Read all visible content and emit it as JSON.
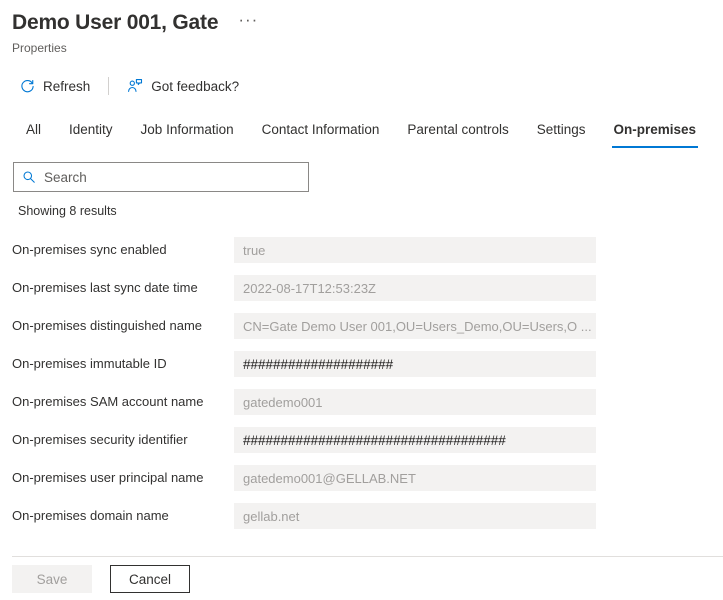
{
  "header": {
    "title": "Demo User 001, Gate",
    "more_label": "···",
    "subtitle": "Properties"
  },
  "commandbar": {
    "refresh_label": "Refresh",
    "feedback_label": "Got feedback?"
  },
  "tabs": [
    {
      "label": "All",
      "active": false
    },
    {
      "label": "Identity",
      "active": false
    },
    {
      "label": "Job Information",
      "active": false
    },
    {
      "label": "Contact Information",
      "active": false
    },
    {
      "label": "Parental controls",
      "active": false
    },
    {
      "label": "Settings",
      "active": false
    },
    {
      "label": "On-premises",
      "active": true
    }
  ],
  "search": {
    "placeholder": "Search",
    "value": ""
  },
  "results": {
    "count_text": "Showing 8 results"
  },
  "properties": [
    {
      "label": "On-premises sync enabled",
      "value": "true",
      "redacted": false
    },
    {
      "label": "On-premises last sync date time",
      "value": "2022-08-17T12:53:23Z",
      "redacted": false
    },
    {
      "label": "On-premises distinguished name",
      "value": "CN=Gate Demo User 001,OU=Users_Demo,OU=Users,O ...",
      "redacted": false
    },
    {
      "label": "On-premises immutable ID",
      "value": "####################",
      "redacted": true
    },
    {
      "label": "On-premises SAM account name",
      "value": "gatedemo001",
      "redacted": false
    },
    {
      "label": "On-premises security identifier",
      "value": "###################################",
      "redacted": true
    },
    {
      "label": "On-premises user principal name",
      "value": "gatedemo001@GELLAB.NET",
      "redacted": false
    },
    {
      "label": "On-premises domain name",
      "value": "gellab.net",
      "redacted": false
    }
  ],
  "footer": {
    "save_label": "Save",
    "cancel_label": "Cancel"
  },
  "colors": {
    "accent": "#0078d4",
    "text": "#323130",
    "muted": "#605e5c",
    "field_bg": "#f3f2f1",
    "placeholder": "#a19f9d"
  }
}
